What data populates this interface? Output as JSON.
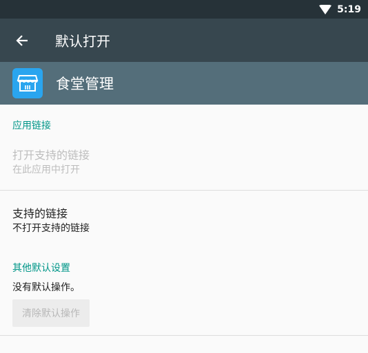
{
  "status_bar": {
    "time": "5:19",
    "icons": [
      "wifi-icon"
    ]
  },
  "toolbar": {
    "title": "默认打开",
    "back_icon": "arrow-back-icon"
  },
  "app": {
    "name": "食堂管理",
    "icon": "storefront-app-icon",
    "icon_color": "#2aa5ef"
  },
  "sections": {
    "app_links": {
      "header": "应用链接",
      "open_supported": {
        "title": "打开支持的链接",
        "subtitle": "在此应用中打开"
      },
      "supported_links": {
        "title": "支持的链接",
        "subtitle": "不打开支持的链接"
      }
    },
    "other_defaults": {
      "header": "其他默认设置",
      "text": "没有默认操作。",
      "clear_button": "清除默认操作"
    }
  },
  "colors": {
    "accent": "#009688",
    "toolbar": "#37474f",
    "app_header": "#546e7a",
    "status_bar": "#263238"
  }
}
